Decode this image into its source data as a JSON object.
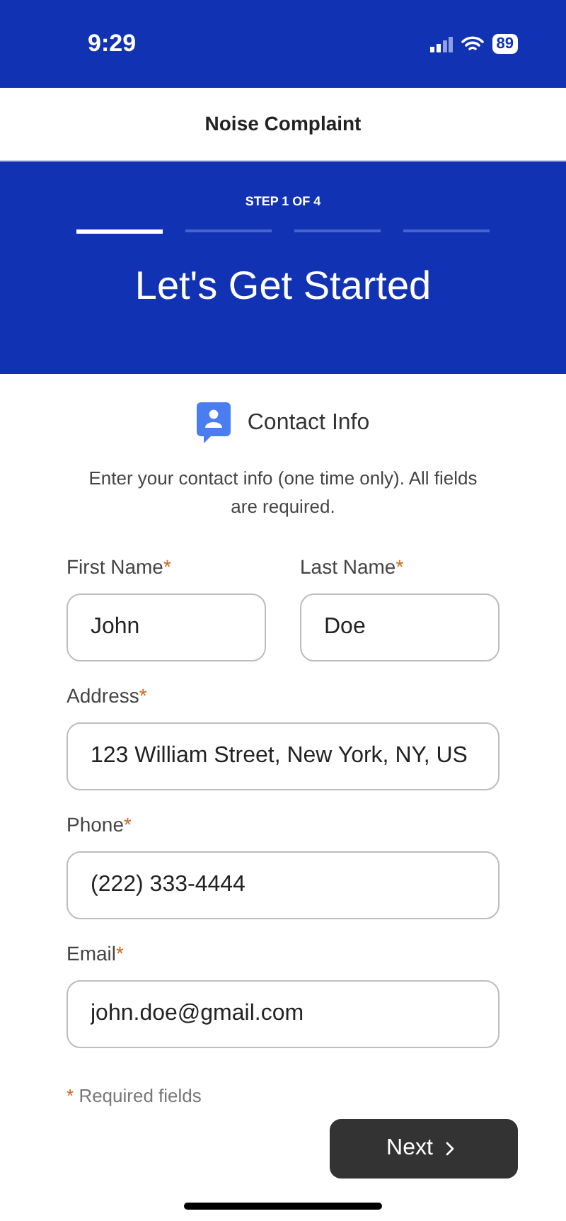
{
  "status_bar": {
    "time": "9:29",
    "battery": "89"
  },
  "header": {
    "title": "Noise Complaint"
  },
  "banner": {
    "step_label": "STEP 1 OF 4",
    "steps": [
      {
        "selected": true
      },
      {
        "selected": false
      },
      {
        "selected": false
      },
      {
        "selected": false
      }
    ],
    "heading": "Let's Get Started"
  },
  "section": {
    "title": "Contact Info",
    "description": "Enter your contact info (one time only). All fields are required."
  },
  "field_rows": [
    {
      "fields": [
        {
          "label": "First Name",
          "mark": "*",
          "value": "John"
        },
        {
          "label": "Last Name",
          "mark": "*",
          "value": "Doe"
        }
      ]
    },
    {
      "fields": [
        {
          "label": "Address",
          "mark": "*",
          "value": "123 William Street, New York, NY, US"
        }
      ]
    },
    {
      "fields": [
        {
          "label": "Phone",
          "mark": "*",
          "value": "(222) 333-4444"
        }
      ]
    },
    {
      "fields": [
        {
          "label": "Email",
          "mark": "*",
          "value": "john.doe@gmail.com"
        }
      ]
    }
  ],
  "footnote": {
    "mark": "*",
    "text": "Required fields"
  },
  "next_button": {
    "label": "Next"
  }
}
